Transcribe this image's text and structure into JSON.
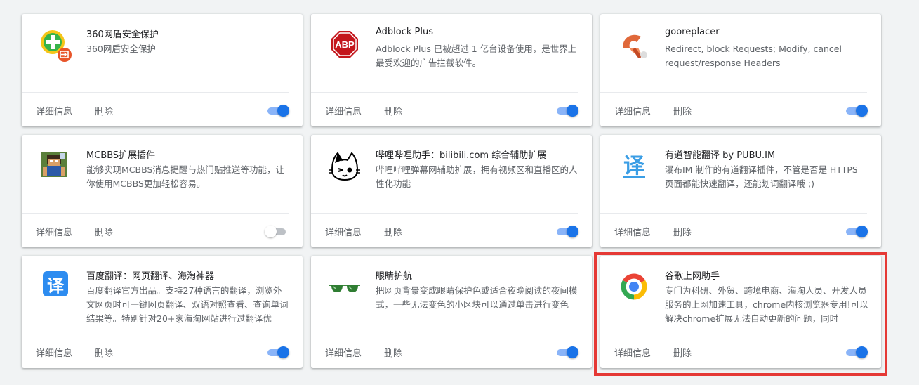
{
  "common": {
    "details_label": "详细信息",
    "remove_label": "删除"
  },
  "extensions": [
    {
      "name": "360网盾安全保护",
      "desc": "360网盾安全保护",
      "icon": "360-shield-icon",
      "enabled": true
    },
    {
      "name": "Adblock Plus",
      "desc": "Adblock Plus 已被超过 1 亿台设备使用，是世界上最受欢迎的广告拦截软件。",
      "icon": "abp-icon",
      "enabled": true
    },
    {
      "name": "gooreplacer",
      "desc": "Redirect, block Requests; Modify, cancel request/response Headers",
      "icon": "gooreplacer-icon",
      "enabled": true
    },
    {
      "name": "MCBBS扩展插件",
      "desc": "能够实现MCBBS消息提醒与热门贴推送等功能，让你使用MCBBS更加轻松容易。",
      "icon": "mcbbs-icon",
      "enabled": false
    },
    {
      "name": "哔哩哔哩助手：bilibili.com 综合辅助扩展",
      "desc": "哔哩哔哩弹幕网辅助扩展，拥有视频区和直播区的人性化功能",
      "icon": "bilibili-cat-icon",
      "enabled": true
    },
    {
      "name": "有道智能翻译 by PUBU.IM",
      "desc": "瀑布IM 制作的有道翻译插件，不管是否是 HTTPS 页面都能快速翻译，还能划词翻译哦 ;)",
      "icon": "youdao-translate-icon",
      "enabled": true
    },
    {
      "name": "百度翻译：网页翻译、海淘神器",
      "desc": "百度翻译官方出品。支持27种语言的翻译，浏览外文网页时可一键网页翻译、双语对照查看、查询单词结果等。特别针对20+家海淘网站进行过翻译优",
      "icon": "baidu-translate-icon",
      "enabled": true
    },
    {
      "name": "眼睛护航",
      "desc": "把网页背景变成眼睛保护色或适合夜晚阅读的夜间模式，一些无法变色的小区块可以通过单击进行变色",
      "icon": "sunglasses-icon",
      "enabled": true
    },
    {
      "name": "谷歌上网助手",
      "desc": "专门为科研、外贸、跨境电商、海淘人员、开发人员服务的上网加速工具，chrome内核浏览器专用!可以解决chrome扩展无法自动更新的问题，同时",
      "icon": "google-helper-icon",
      "enabled": true
    }
  ]
}
